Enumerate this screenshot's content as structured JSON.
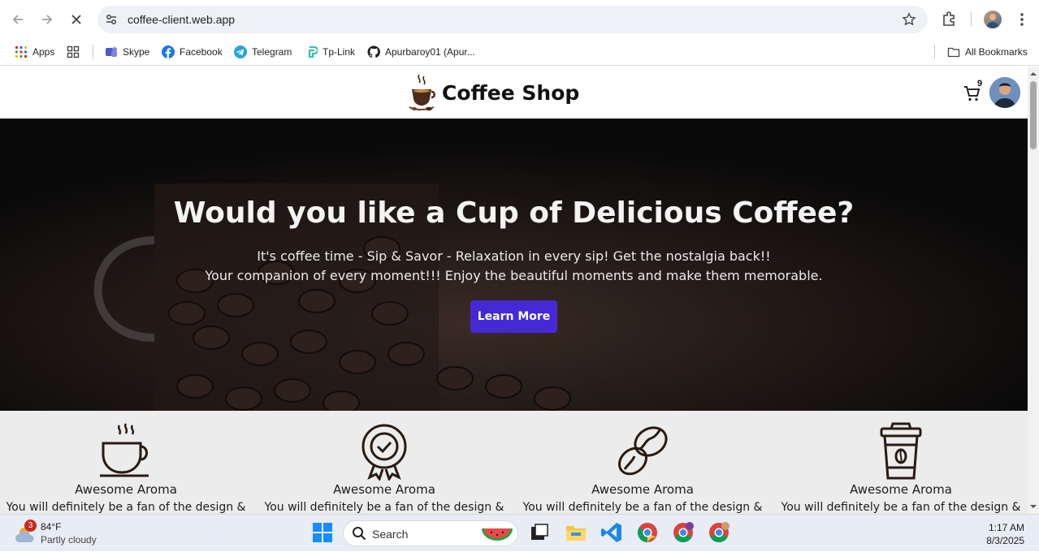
{
  "browser": {
    "url": "coffee-client.web.app"
  },
  "bookmarks": [
    {
      "label": "Apps",
      "icon": "apps-grid-icon"
    },
    {
      "label": "Skype",
      "icon": "skype-icon"
    },
    {
      "label": "Facebook",
      "icon": "facebook-icon"
    },
    {
      "label": "Telegram",
      "icon": "telegram-icon"
    },
    {
      "label": "Tp-Link",
      "icon": "tplink-icon"
    },
    {
      "label": "Apurbaroy01 (Apur...",
      "icon": "github-icon"
    }
  ],
  "all_bookmarks": "All Bookmarks",
  "site": {
    "brand": "Coffee Shop",
    "cart_count": "9",
    "hero": {
      "title": "Would you like a Cup of Delicious Coffee?",
      "line1": "It's coffee time - Sip & Savor - Relaxation in every sip! Get the nostalgia back!!",
      "line2": "Your companion of every moment!!! Enjoy the beautiful moments and make them memorable.",
      "button": "Learn More"
    },
    "features": [
      {
        "icon": "coffee-cup-icon",
        "title": "Awesome Aroma",
        "desc": "You will definitely be a fan of the design &"
      },
      {
        "icon": "quality-badge-icon",
        "title": "Awesome Aroma",
        "desc": "You will definitely be a fan of the design &"
      },
      {
        "icon": "coffee-bean-icon",
        "title": "Awesome Aroma",
        "desc": "You will definitely be a fan of the design &"
      },
      {
        "icon": "takeaway-cup-icon",
        "title": "Awesome Aroma",
        "desc": "You will definitely be a fan of the design &"
      }
    ]
  },
  "taskbar": {
    "weather_badge": "3",
    "temperature": "84°F",
    "condition": "Partly cloudy",
    "search": "Search",
    "time": "1:17 AM",
    "date": "8/3/2025"
  },
  "colors": {
    "accent_button": "#4629d6",
    "hero_bg": "#0e0c0b",
    "features_bg": "#ececec"
  }
}
